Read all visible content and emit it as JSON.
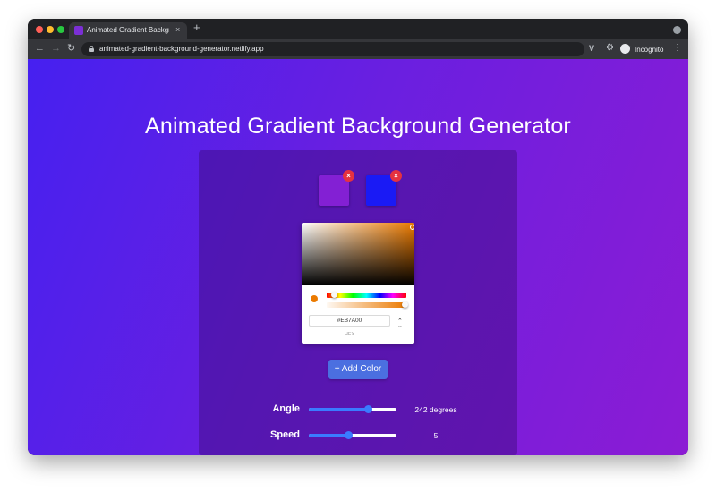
{
  "browser": {
    "tab_title": "Animated Gradient Background Generator",
    "tab_close": "×",
    "new_tab": "+",
    "url": "animated-gradient-background-generator.netlify.app",
    "incognito_label": "Incognito",
    "icons": [
      "back-arrow-icon",
      "forward-arrow-icon",
      "reload-icon",
      "lock-icon",
      "star-icon",
      "extension-v-icon",
      "puzzle-icon",
      "incognito-icon",
      "menu-dots-icon"
    ]
  },
  "page": {
    "title": "Animated Gradient Background Generator"
  },
  "colors": {
    "swatches": [
      {
        "hex": "#8320D4",
        "remove_label": "×"
      },
      {
        "hex": "#1A1AF5",
        "remove_label": "×"
      }
    ],
    "accent": "#3A7BFF"
  },
  "picker": {
    "hex_value": "#EB7A00",
    "hex_label": "HEX",
    "hue_level": 0.09,
    "alpha_level": 1.0
  },
  "add_color": {
    "label": "+ Add Color"
  },
  "controls": {
    "angle": {
      "label": "Angle",
      "value_text": "242 degrees",
      "level": 0.67
    },
    "speed": {
      "label": "Speed",
      "value_text": "5",
      "level": 0.45
    }
  }
}
